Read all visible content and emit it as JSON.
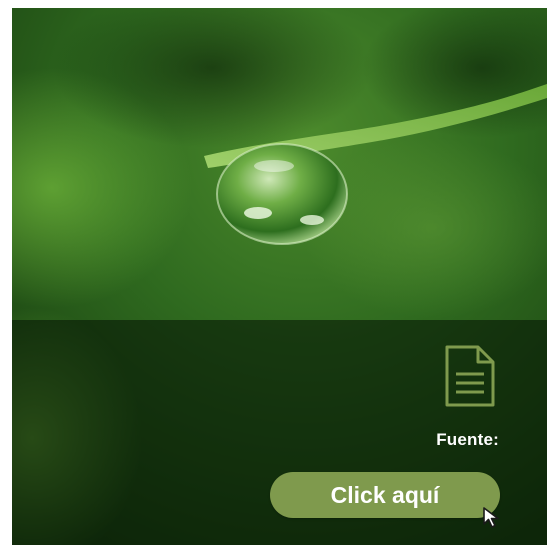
{
  "card": {
    "image_subject": "leaf-water-drop",
    "source_label": "Fuente:",
    "icon": "document-icon",
    "cta_label": "Click aquí"
  },
  "colors": {
    "accent": "#7f9a4d",
    "overlay": "#0d2409",
    "label_text": "#ffffff"
  }
}
